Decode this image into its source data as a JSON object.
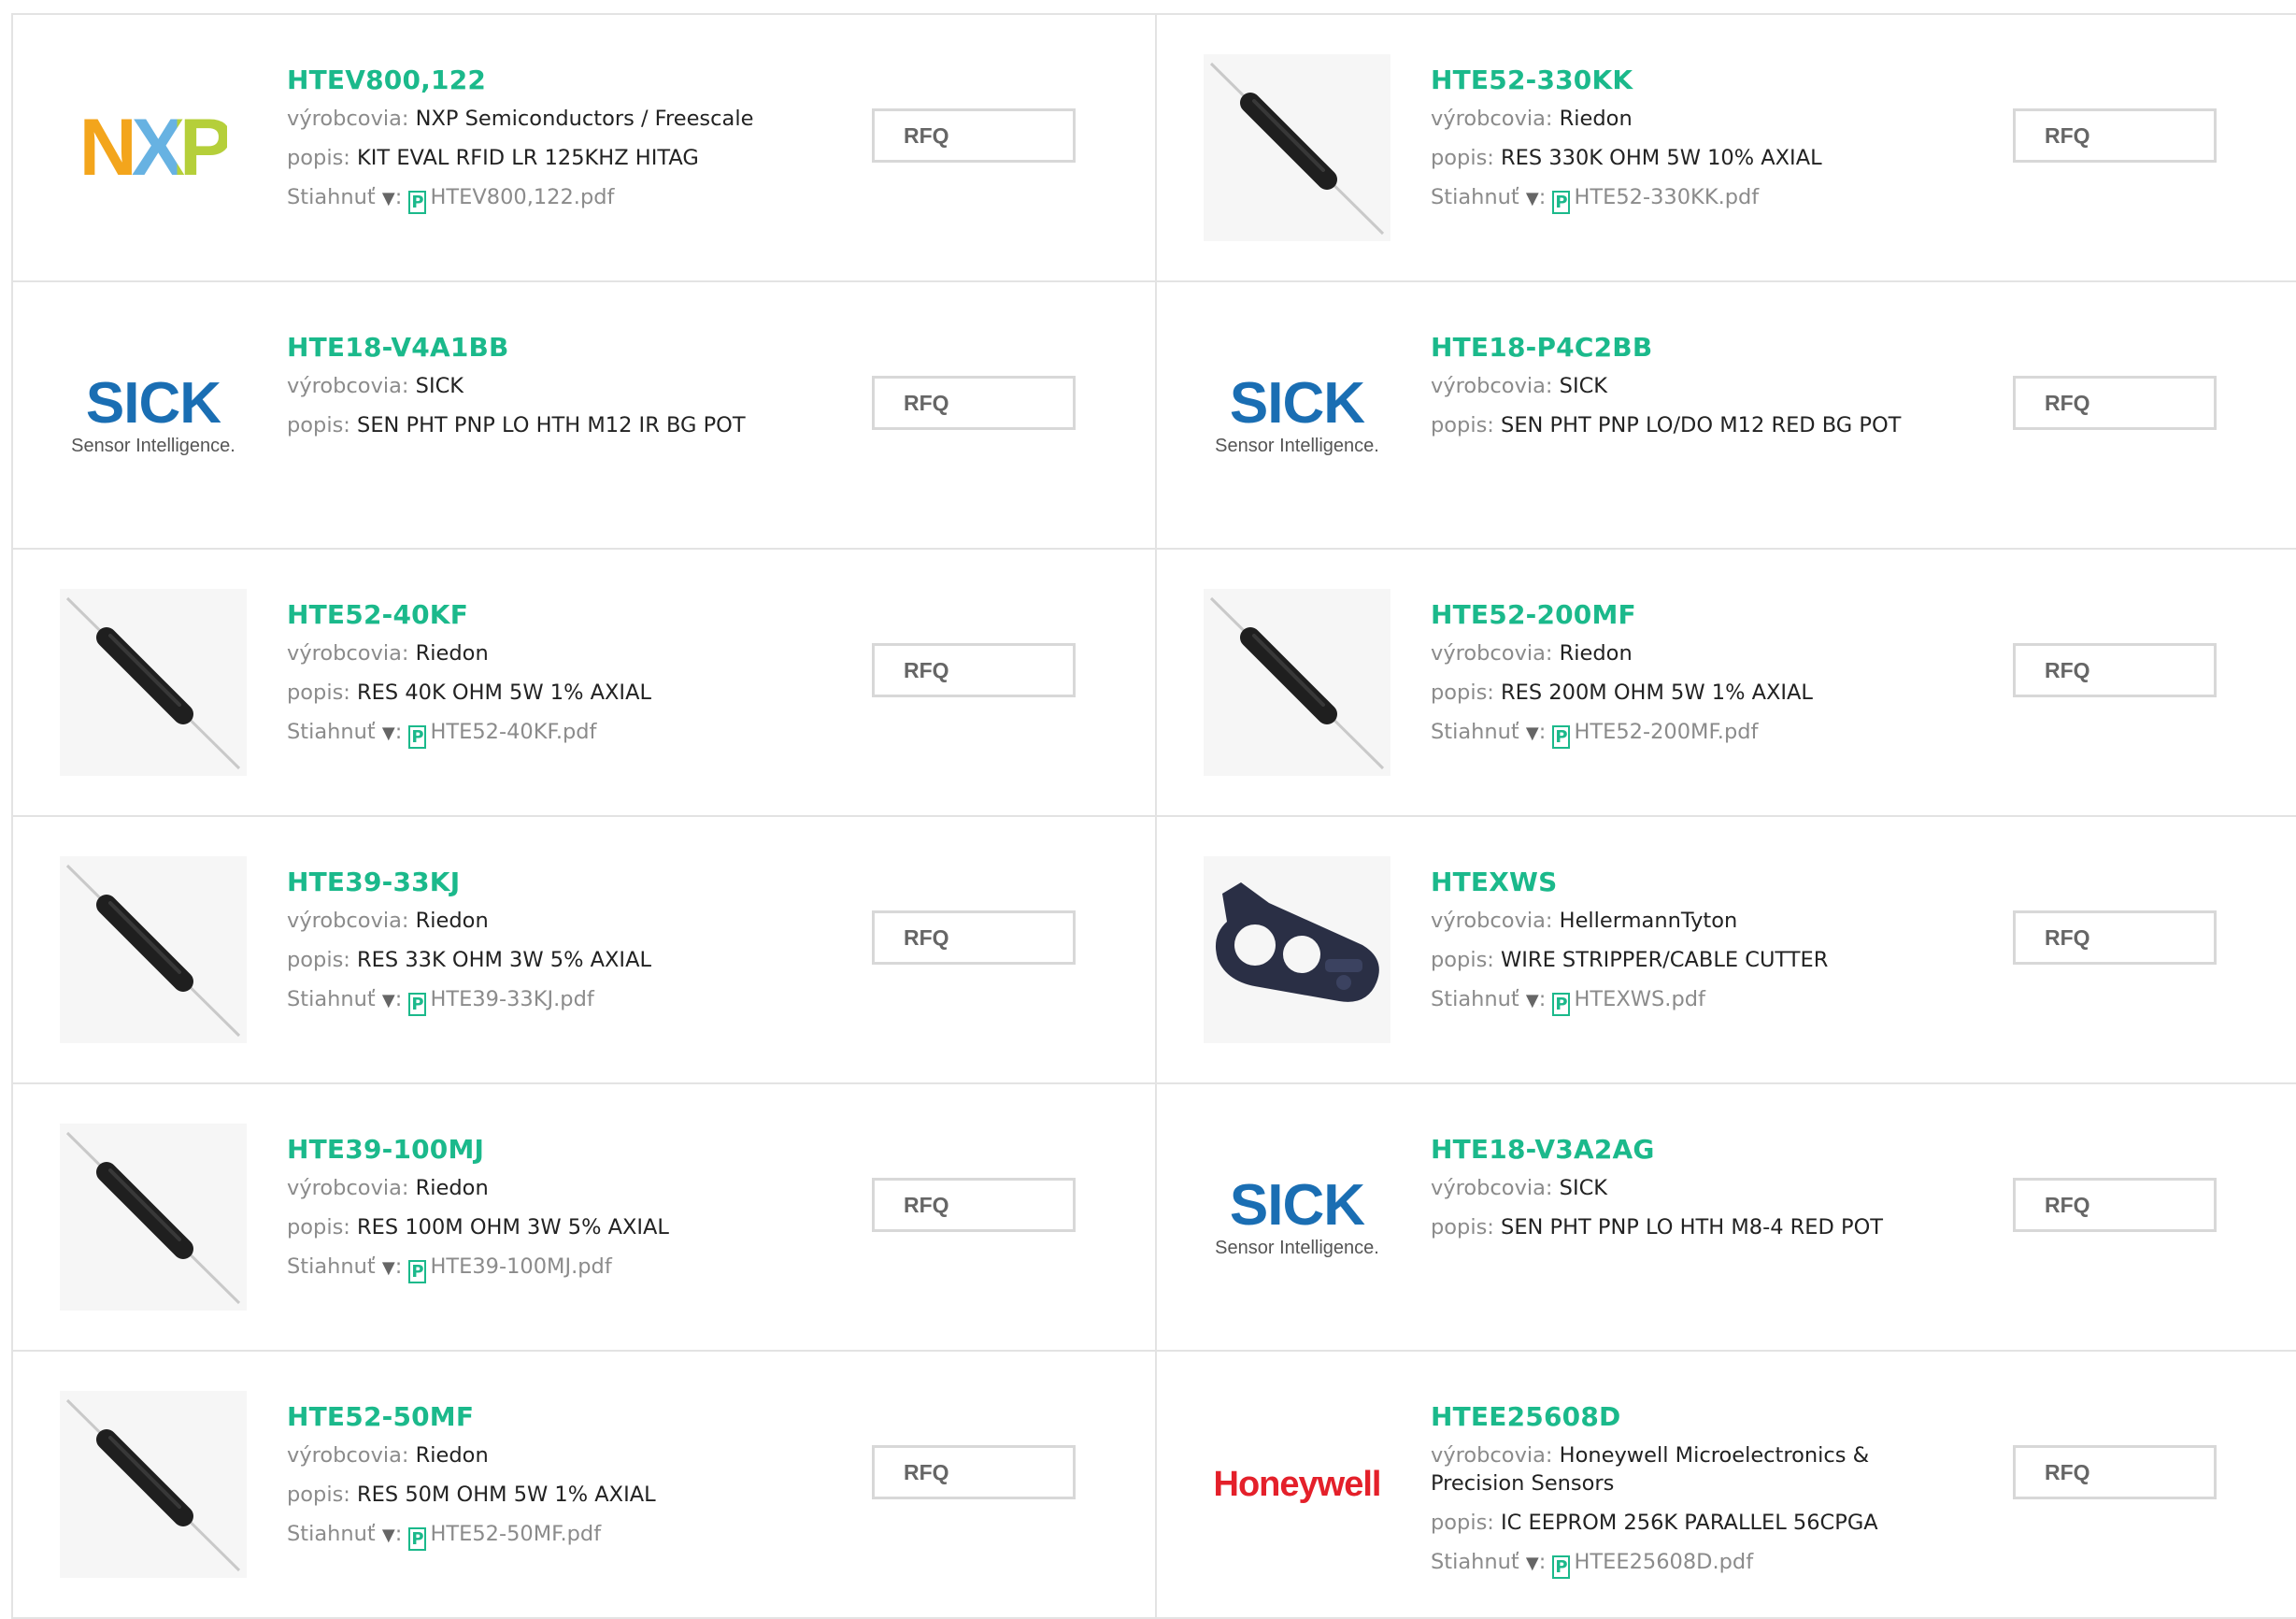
{
  "labels": {
    "manufacturer": "výrobcovia: ",
    "description": "popis: ",
    "download": "Stiahnuť ",
    "download_arrow": "▼",
    "download_colon": ": ",
    "pdf_glyph": "P",
    "rfq": "RFQ"
  },
  "colors": {
    "title_green": "#1bb98b",
    "label_grey": "#8b8b8b",
    "border": "#e3e3e3"
  },
  "products": [
    {
      "part": "HTEV800,122",
      "manufacturer": "NXP Semiconductors / Freescale",
      "description": "KIT EVAL RFID LR 125KHZ HITAG",
      "pdf": "HTEV800,122.pdf",
      "thumb": "nxp-logo"
    },
    {
      "part": "HTE52-330KK",
      "manufacturer": "Riedon",
      "description": "RES 330K OHM 5W 10% AXIAL",
      "pdf": "HTE52-330KK.pdf",
      "thumb": "resistor-photo"
    },
    {
      "part": "HTE18-V4A1BB",
      "manufacturer": "SICK",
      "description": "SEN PHT PNP LO HTH M12 IR BG POT",
      "pdf": null,
      "thumb": "sick-logo"
    },
    {
      "part": "HTE18-P4C2BB",
      "manufacturer": "SICK",
      "description": "SEN PHT PNP LO/DO M12 RED BG POT",
      "pdf": null,
      "thumb": "sick-logo"
    },
    {
      "part": "HTE52-40KF",
      "manufacturer": "Riedon",
      "description": "RES 40K OHM 5W 1% AXIAL",
      "pdf": "HTE52-40KF.pdf",
      "thumb": "resistor-photo"
    },
    {
      "part": "HTE52-200MF",
      "manufacturer": "Riedon",
      "description": "RES 200M OHM 5W 1% AXIAL",
      "pdf": "HTE52-200MF.pdf",
      "thumb": "resistor-photo"
    },
    {
      "part": "HTE39-33KJ",
      "manufacturer": "Riedon",
      "description": "RES 33K OHM 3W 5% AXIAL",
      "pdf": "HTE39-33KJ.pdf",
      "thumb": "resistor-photo"
    },
    {
      "part": "HTEXWS",
      "manufacturer": "HellermannTyton",
      "description": "WIRE STRIPPER/CABLE CUTTER",
      "pdf": "HTEXWS.pdf",
      "thumb": "wire-stripper-photo"
    },
    {
      "part": "HTE39-100MJ",
      "manufacturer": "Riedon",
      "description": "RES 100M OHM 3W 5% AXIAL",
      "pdf": "HTE39-100MJ.pdf",
      "thumb": "resistor-photo"
    },
    {
      "part": "HTE18-V3A2AG",
      "manufacturer": "SICK",
      "description": "SEN PHT PNP LO HTH M8-4 RED POT",
      "pdf": null,
      "thumb": "sick-logo"
    },
    {
      "part": "HTE52-50MF",
      "manufacturer": "Riedon",
      "description": "RES 50M OHM 5W 1% AXIAL",
      "pdf": "HTE52-50MF.pdf",
      "thumb": "resistor-photo"
    },
    {
      "part": "HTEE25608D",
      "manufacturer": "Honeywell Microelectronics & Precision Sensors",
      "description": "IC EEPROM 256K PARALLEL 56CPGA",
      "pdf": "HTEE25608D.pdf",
      "thumb": "honeywell-logo"
    }
  ],
  "logos": {
    "nxp": "NXP",
    "sick": "SICK",
    "sick_tagline": "Sensor Intelligence.",
    "honeywell": "Honeywell"
  }
}
